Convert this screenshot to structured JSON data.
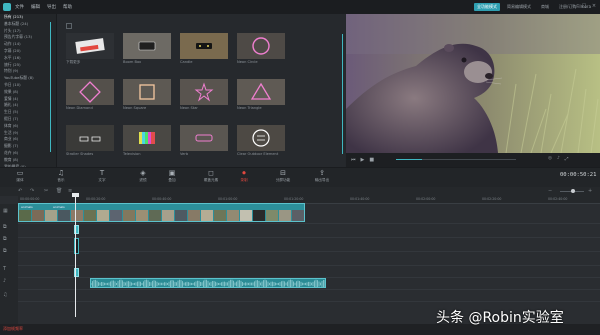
{
  "menubar": {
    "items": [
      "文件",
      "编辑",
      "导出",
      "帮助"
    ],
    "mode_tabs": [
      "全功能模式",
      "简易编辑模式",
      "商城",
      "注册/订购Filmora"
    ],
    "active_mode": 0
  },
  "categories": [
    "所有 (213)",
    "基本标题 (24)",
    "片头 (17)",
    "预告片字幕 (13)",
    "动作 (14)",
    "字幕 (20)",
    "水平 (16)",
    "旅行 (25)",
    "特别 (9)",
    "YouTube标题 (8)",
    "节日 (10)",
    "效果 (8)",
    "爱情 (4)",
    "婚礼 (4)",
    "生日 (5)",
    "假日 (7)",
    "体育 (6)",
    "生活 (9)",
    "商业 (6)",
    "摄影 (7)",
    "花卉 (6)",
    "教育 (8)",
    "我的最爱 (0)"
  ],
  "thumbnails": [
    {
      "label": "下载更多",
      "style": "download"
    },
    {
      "label": "Boom Box",
      "style": "boombox"
    },
    {
      "label": "Candle",
      "style": "candle"
    },
    {
      "label": "Neon Circle",
      "style": "neon-circle"
    },
    {
      "label": "Neon Diamond",
      "style": "neon-diamond"
    },
    {
      "label": "Neon Square",
      "style": "neon-square"
    },
    {
      "label": "Neon Star",
      "style": "neon-star"
    },
    {
      "label": "Neon Triangle",
      "style": "neon-triangle"
    },
    {
      "label": "Stroller Shades",
      "style": "shades"
    },
    {
      "label": "Television",
      "style": "tv"
    },
    {
      "label": "Verb",
      "style": "verb"
    },
    {
      "label": "Clear Outdoor Element",
      "style": "element"
    },
    {
      "label": "",
      "style": "fire"
    },
    {
      "label": "",
      "style": "goggles"
    },
    {
      "label": "",
      "style": "flag"
    },
    {
      "label": "",
      "style": "helmet"
    }
  ],
  "toolbar": {
    "tools": [
      {
        "icon": "media-icon",
        "glyph": "▭",
        "label": "媒体"
      },
      {
        "icon": "music-icon",
        "glyph": "♫",
        "label": "音乐"
      },
      {
        "icon": "text-icon",
        "glyph": "T",
        "label": "文字"
      },
      {
        "icon": "filter-icon",
        "glyph": "◈",
        "label": "滤镜"
      },
      {
        "icon": "overlay-icon",
        "glyph": "▣",
        "label": "叠加"
      },
      {
        "icon": "element-icon",
        "glyph": "◻",
        "label": "覆盖元素"
      },
      {
        "icon": "record-icon",
        "glyph": "⏺",
        "label": "录制"
      },
      {
        "icon": "split-icon",
        "glyph": "⊟",
        "label": "分屏功能"
      },
      {
        "icon": "export-icon",
        "glyph": "⇪",
        "label": "输出导出"
      }
    ]
  },
  "preview": {
    "timecode": "00:00:50:21",
    "progress": 0.22
  },
  "timeline": {
    "ruler_labels": [
      "00:00:00:00",
      "00:00:20:00",
      "00:00:40:00",
      "00:01:00:00",
      "00:01:20:00",
      "00:01:40:00",
      "00:02:00:00",
      "00:02:20:00",
      "00:02:40:00"
    ],
    "clip_labels": [
      "animals",
      "animals"
    ]
  },
  "status": {
    "text": "添加帧频率"
  },
  "watermark": "头条 @Robin实验室",
  "colors": {
    "accent": "#3fb7c1",
    "record": "#e2483f"
  }
}
